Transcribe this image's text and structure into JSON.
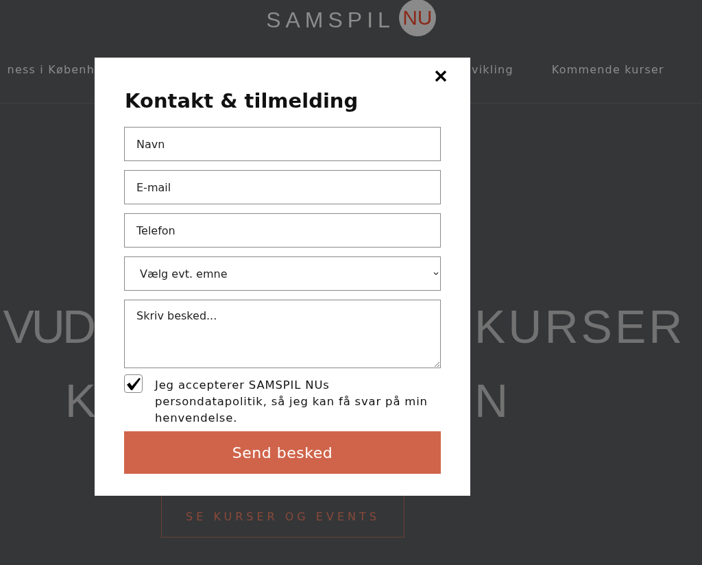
{
  "header": {
    "wordmark": "SAMSPIL",
    "badge": "NU"
  },
  "nav": {
    "left": "ness i Københ",
    "right": [
      {
        "label": "vikling"
      },
      {
        "label": "Kommende kurser"
      }
    ]
  },
  "hero": {
    "lines": [
      {
        "left": "VUD",
        "right": "KURSER"
      },
      {
        "left": "K",
        "right": "N"
      }
    ],
    "button": "SE KURSER OG EVENTS"
  },
  "modal": {
    "title": "Kontakt & tilmelding",
    "fields": [
      {
        "kind": "input",
        "placeholder": "Navn"
      },
      {
        "kind": "input",
        "placeholder": "E-mail"
      },
      {
        "kind": "input",
        "placeholder": "Telefon"
      },
      {
        "kind": "select",
        "value": "Vælg evt. emne"
      },
      {
        "kind": "textarea",
        "placeholder": "Skriv besked..."
      }
    ],
    "consent": {
      "checked": true,
      "text": "Jeg accepterer SAMSPIL NUs persondatapolitik, så jeg kan få svar på min henvendelse."
    },
    "submit": "Send besked"
  }
}
